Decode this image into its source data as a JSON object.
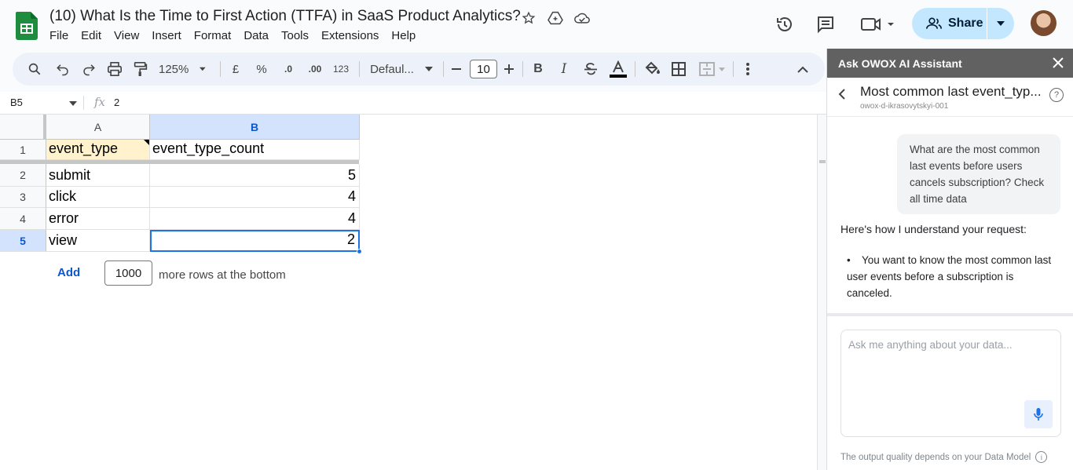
{
  "doc": {
    "title": "(10) What Is the Time to First Action (TTFA) in SaaS Product Analytics?",
    "menu": [
      "File",
      "Edit",
      "View",
      "Insert",
      "Format",
      "Data",
      "Tools",
      "Extensions",
      "Help"
    ],
    "share_label": "Share"
  },
  "toolbar": {
    "zoom": "125%",
    "currency": "£",
    "percent": "%",
    "dec_decrease": ".0",
    "dec_increase": ".00",
    "number_format": "123",
    "font": "Defaul...",
    "font_size": "10",
    "bold": "B",
    "italic": "I"
  },
  "formula_bar": {
    "name_box": "B5",
    "fx": "fx",
    "value": "2"
  },
  "grid": {
    "columns": [
      "A",
      "B"
    ],
    "rows": [
      {
        "num": "1",
        "a": "event_type",
        "b": "event_type_count"
      },
      {
        "num": "2",
        "a": "submit",
        "b": "5"
      },
      {
        "num": "3",
        "a": "click",
        "b": "4"
      },
      {
        "num": "4",
        "a": "error",
        "b": "4"
      },
      {
        "num": "5",
        "a": "view",
        "b": "2"
      }
    ],
    "add_label": "Add",
    "add_count": "1000",
    "add_suffix": "more rows at the bottom"
  },
  "panel": {
    "header": "Ask OWOX AI Assistant",
    "chat_title": "Most common last event_typ...",
    "chat_subtitle": "owox-d-ikrasovytskyi-001",
    "user_message": "What are the most common last events before users cancels subscription? Check all time data",
    "ai_intro": "Here's how I understand your request:",
    "ai_bullet": "You want to know the most common last user events before a subscription is canceled.",
    "input_placeholder": "Ask me anything about your data...",
    "footer": "The output quality depends on your Data Model"
  },
  "colors": {
    "selected_header": "#d3e3fd",
    "header_cell_fill": "#fff2cc",
    "selection_border": "#1a73e8",
    "share_bg": "#c2e7ff"
  }
}
